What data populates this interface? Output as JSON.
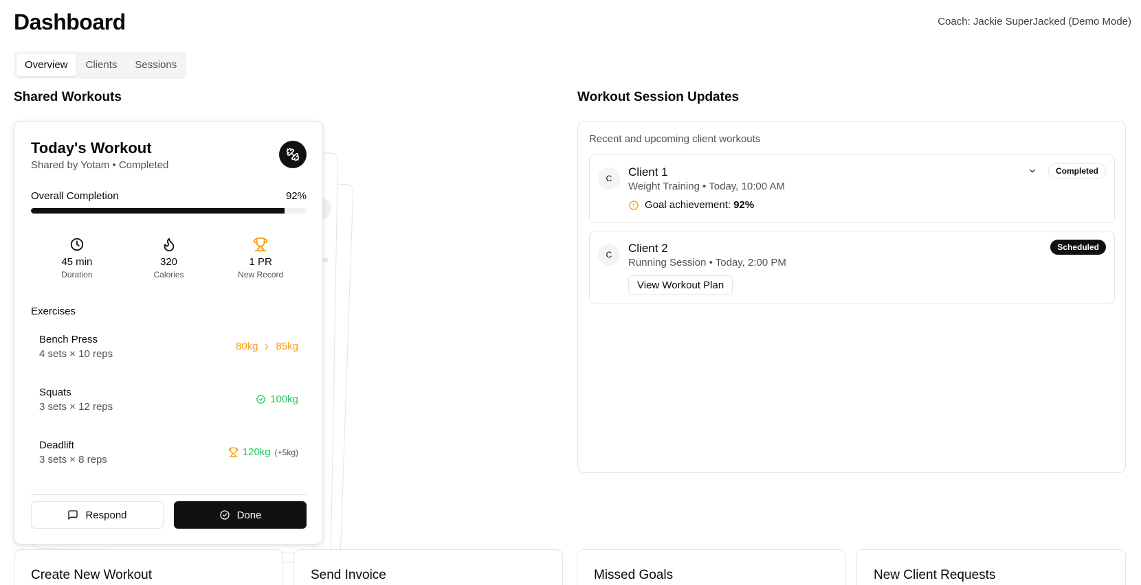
{
  "header": {
    "title": "Dashboard",
    "coach": "Coach: Jackie SuperJacked (Demo Mode)"
  },
  "tabs": [
    {
      "label": "Overview",
      "active": true
    },
    {
      "label": "Clients",
      "active": false
    },
    {
      "label": "Sessions",
      "active": false
    }
  ],
  "shared_workouts": {
    "section_title": "Shared Workouts",
    "card": {
      "title": "Today's Workout",
      "subtitle": "Shared by Yotam • Completed",
      "action_icon": "dumbbell-icon",
      "completion_label": "Overall Completion",
      "completion_value": "92%",
      "completion_fraction": 0.92,
      "stats": [
        {
          "icon": "clock-icon",
          "value": "45 min",
          "label": "Duration"
        },
        {
          "icon": "flame-icon",
          "value": "320",
          "label": "Calories"
        },
        {
          "icon": "trophy-icon",
          "value": "1 PR",
          "label": "New Record"
        }
      ],
      "exercises_label": "Exercises",
      "exercises": [
        {
          "name": "Bench Press",
          "detail": "4 sets × 10 reps",
          "from": "80kg",
          "to": "85kg"
        },
        {
          "name": "Squats",
          "detail": "3 sets × 12 reps",
          "value": "100kg"
        },
        {
          "name": "Deadlift",
          "detail": "3 sets × 8 reps",
          "value": "120kg",
          "extra": "(+5kg)"
        }
      ],
      "respond_label": "Respond",
      "done_label": "Done"
    }
  },
  "session_updates": {
    "section_title": "Workout Session Updates",
    "description": "Recent and upcoming client workouts",
    "sessions": [
      {
        "avatar": "C",
        "name": "Client 1",
        "detail": "Weight Training • Today, 10:00 AM",
        "status": "Completed",
        "goal_label": "Goal achievement:",
        "goal_value": "92%"
      },
      {
        "avatar": "C",
        "name": "Client 2",
        "detail": "Running Session • Today, 2:00 PM",
        "status": "Scheduled",
        "button_label": "View Workout Plan"
      }
    ]
  },
  "bottom_cards": [
    {
      "label": "Create New Workout"
    },
    {
      "label": "Send Invoice"
    },
    {
      "label": "Missed Goals"
    },
    {
      "label": "New Client Requests"
    }
  ],
  "colors": {
    "accent_orange": "#f59e0b",
    "success_green": "#22c55e",
    "primary_dark": "#111111",
    "border": "#e4e4e7"
  }
}
